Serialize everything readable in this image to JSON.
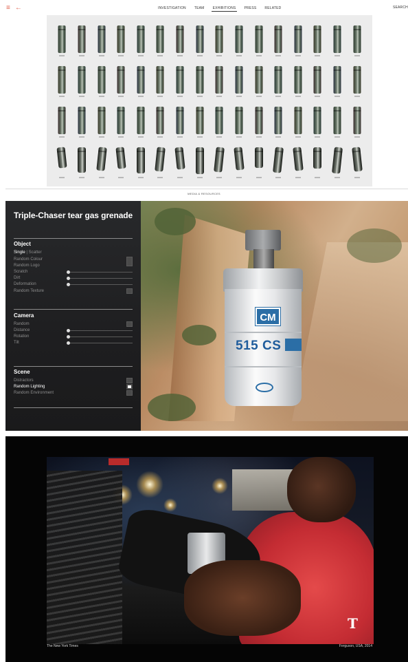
{
  "nav": {
    "menu_icon": "hamburger-icon",
    "back_icon": "arrow-left-icon",
    "items": [
      "INVESTIGATION",
      "TEAM",
      "EXHIBITIONS",
      "PRESS",
      "RELATED"
    ],
    "active_index": 2,
    "search_label": "SEARCH",
    "accent_color": "#e0604d"
  },
  "gallery": {
    "rows": 4,
    "columns": 16
  },
  "section_label": "MEDIA & RESOURCES",
  "synth_panel": {
    "title": "Triple-Chaser tear gas grenade",
    "object": {
      "heading": "Object",
      "mode_options": [
        "Single",
        "Scatter"
      ],
      "mode_selected": "Single",
      "options": [
        "Random Colour",
        "Random Logo",
        "Scratch",
        "Dirt",
        "Deformation",
        "Random Texture"
      ]
    },
    "camera": {
      "heading": "Camera",
      "options": [
        "Random",
        "Distance",
        "Rotation",
        "Tilt"
      ]
    },
    "scene": {
      "heading": "Scene",
      "options": [
        "Distractors",
        "Random Lighting",
        "Random Environment"
      ],
      "selected": "Random Lighting"
    },
    "grenade_logo": "CM",
    "grenade_label": "515 CS"
  },
  "video": {
    "credit": "The New York Times",
    "caption": "Ferguson, USA, 2014",
    "watermark": "T"
  }
}
